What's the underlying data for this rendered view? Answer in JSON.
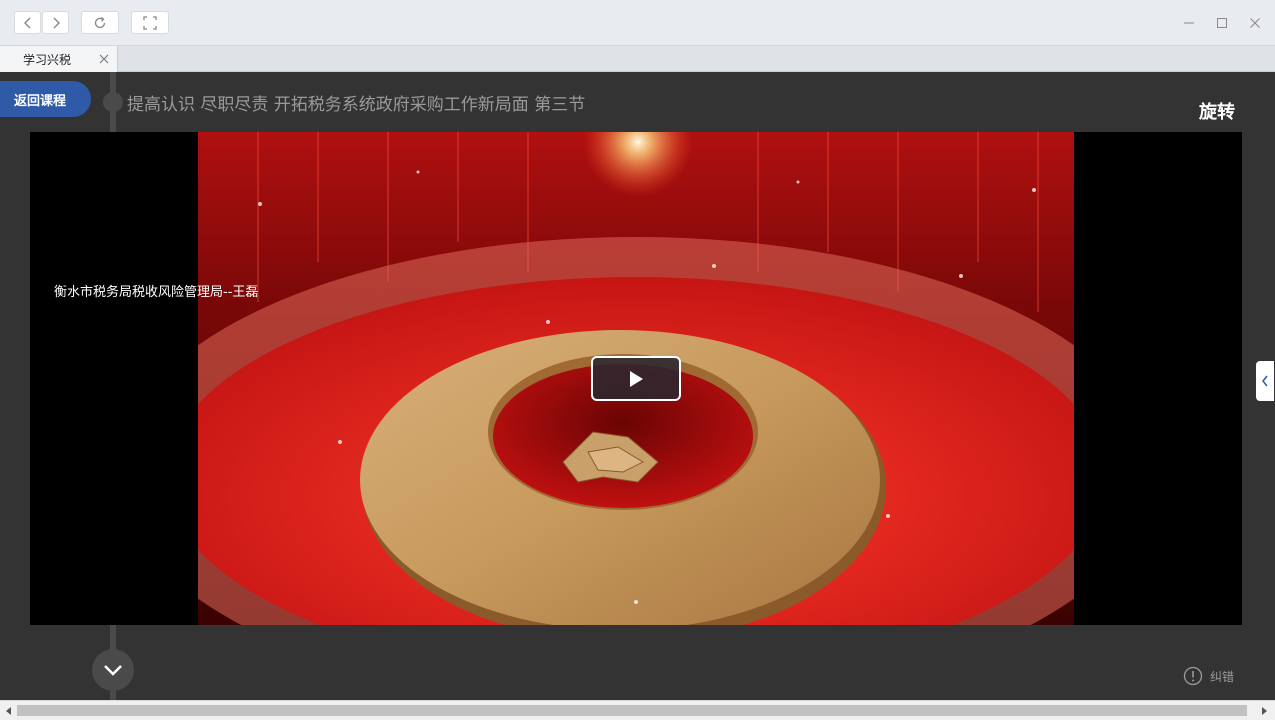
{
  "browser": {
    "tab": {
      "label": "学习兴税"
    }
  },
  "page": {
    "back_button": "返回课程",
    "course_title": "提高认识 尽职尽责 开拓税务系统政府采购工作新局面 第三节",
    "rotate_button": "旋转",
    "report_error": "纠错"
  },
  "video": {
    "speaker_caption": "衡水市税务局税收风险管理局--王磊",
    "icons": [
      "play-icon"
    ]
  },
  "colors": {
    "accent": "#2f5aa8",
    "background": "#333333",
    "video_red": "#d81e1e",
    "gold": "#c9a06a"
  }
}
